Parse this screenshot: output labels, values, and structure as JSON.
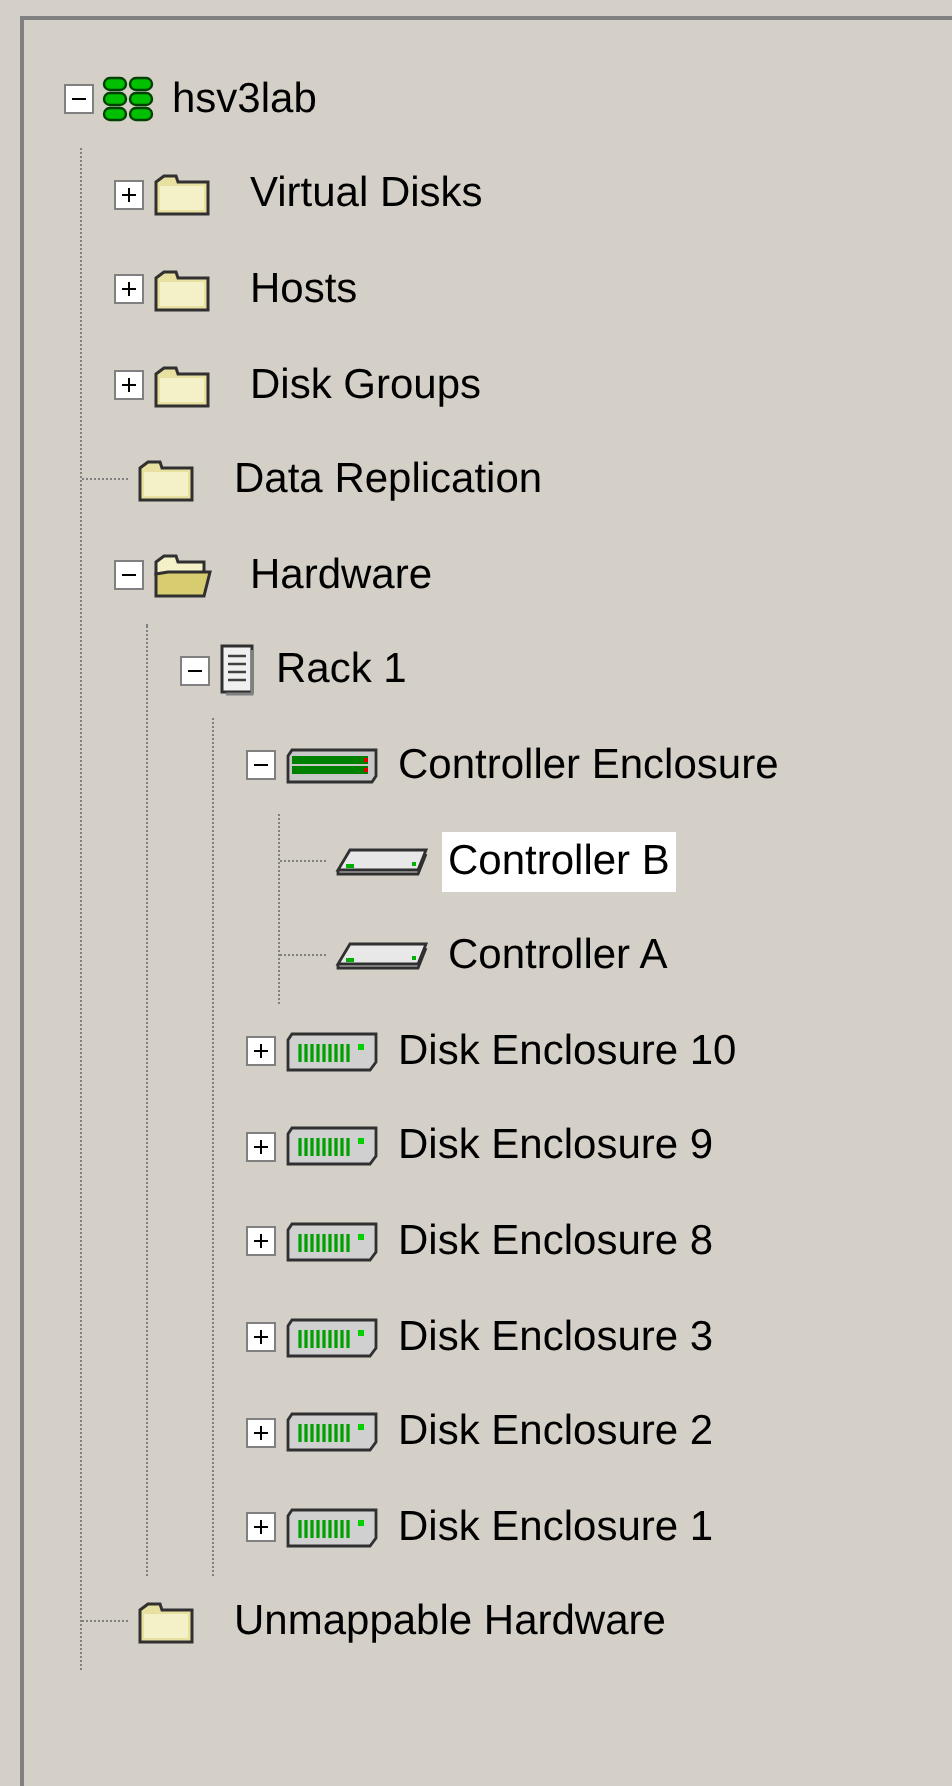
{
  "tree": [
    {
      "label": "hsv3lab",
      "kind": "system",
      "expanded": true,
      "selected": false,
      "children": [
        {
          "label": "Virtual Disks",
          "kind": "folder",
          "expanded": false,
          "selected": false
        },
        {
          "label": "Hosts",
          "kind": "folder",
          "expanded": false,
          "selected": false
        },
        {
          "label": "Disk Groups",
          "kind": "folder",
          "expanded": false,
          "selected": false
        },
        {
          "label": "Data Replication",
          "kind": "folder",
          "selected": false
        },
        {
          "label": "Hardware",
          "kind": "folder",
          "expanded": true,
          "selected": false,
          "children": [
            {
              "label": "Rack 1",
              "kind": "rack",
              "expanded": true,
              "selected": false,
              "children": [
                {
                  "label": "Controller Enclosure",
                  "kind": "controller_enclosure",
                  "expanded": true,
                  "selected": false,
                  "children": [
                    {
                      "label": "Controller B",
                      "kind": "controller",
                      "selected": true
                    },
                    {
                      "label": "Controller A",
                      "kind": "controller",
                      "selected": false
                    }
                  ]
                },
                {
                  "label": "Disk Enclosure 10",
                  "kind": "disk_enclosure",
                  "expanded": false,
                  "selected": false
                },
                {
                  "label": "Disk Enclosure 9",
                  "kind": "disk_enclosure",
                  "expanded": false,
                  "selected": false
                },
                {
                  "label": "Disk Enclosure 8",
                  "kind": "disk_enclosure",
                  "expanded": false,
                  "selected": false
                },
                {
                  "label": "Disk Enclosure 3",
                  "kind": "disk_enclosure",
                  "expanded": false,
                  "selected": false
                },
                {
                  "label": "Disk Enclosure 2",
                  "kind": "disk_enclosure",
                  "expanded": false,
                  "selected": false
                },
                {
                  "label": "Disk Enclosure 1",
                  "kind": "disk_enclosure",
                  "expanded": false,
                  "selected": false
                }
              ]
            }
          ]
        },
        {
          "label": "Unmappable Hardware",
          "kind": "folder",
          "selected": false
        }
      ]
    }
  ]
}
